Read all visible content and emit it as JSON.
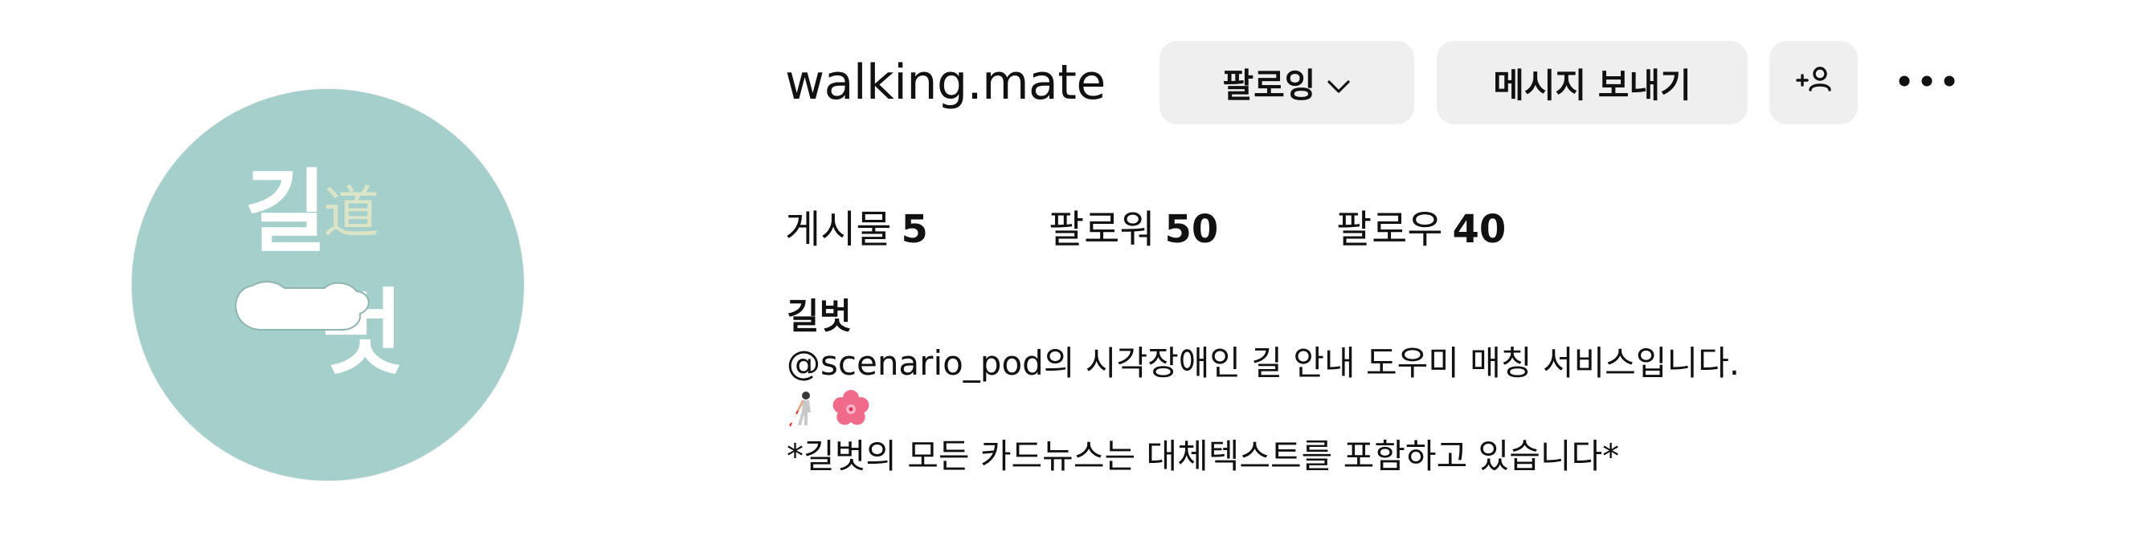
{
  "profile": {
    "username": "walking.mate",
    "avatar_logo_text": "길벗 道"
  },
  "actions": {
    "follow_label": "팔로잉",
    "message_label": "메시지 보내기",
    "suggest_icon": "add-person-icon",
    "more_icon": "more-dots-icon"
  },
  "stats": {
    "posts_label": "게시물",
    "posts_count": "5",
    "followers_label": "팔로워",
    "followers_count": "50",
    "following_label": "팔로우",
    "following_count": "40"
  },
  "bio": {
    "display_name": "길벗",
    "line1": "@scenario_pod의 시각장애인 길 안내 도우미 매칭 서비스입니다.",
    "emojis": [
      "person-with-white-cane-icon",
      "cherry-blossom-icon"
    ],
    "line3": "*길벗의 모든 카드뉴스는 대체텍스트를 포함하고 있습니다*"
  },
  "colors": {
    "avatar_bg": "#a4cfca",
    "button_bg": "#efefef",
    "text": "#111111",
    "blossom": "#f06a8a"
  }
}
